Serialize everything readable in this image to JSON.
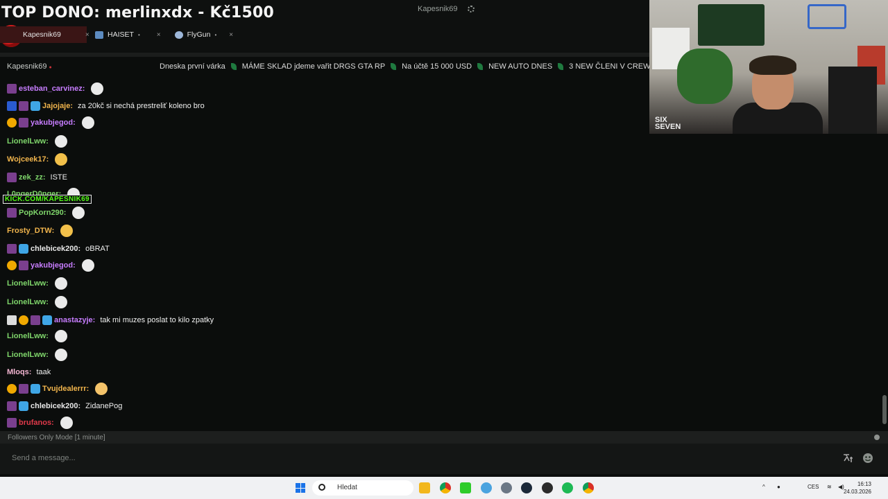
{
  "overlay": {
    "top_title": "TOP DONO: merlinxdx - Kč1500",
    "center_channel": "Kapesnik69"
  },
  "tabs": [
    {
      "label": "Kapesnik69",
      "close": "×"
    },
    {
      "label": "HAISET",
      "dot": "•",
      "close": "×"
    },
    {
      "label": "FlyGun",
      "dot": "•",
      "close": "×"
    }
  ],
  "channel": {
    "name": "Kapesnik69",
    "ticker": [
      "Dneska první várka",
      "MÁME SKLAD jdeme vařit DRGS GTA RP",
      "Na účtě 15 000 USD",
      "NEW AUTO DNES",
      "3 NEW ČLENI V CREW"
    ]
  },
  "webcam": {
    "overlay_text": "SIX SEVEN"
  },
  "kick_overlay": "KICK.COM/KAPESNIK69",
  "chat": [
    {
      "badges": [
        "sub"
      ],
      "user": "esteban_carvinez:",
      "color": "#c77dff",
      "text": "",
      "emote": "skull-emote"
    },
    {
      "badges": [
        "mod",
        "sub",
        "gift"
      ],
      "user": "Jajojaje:",
      "color": "#f0b44c",
      "text": "za 20kč si nechá prestreliť koleno bro",
      "emote": ""
    },
    {
      "badges": [
        "one",
        "sub"
      ],
      "user": "yakubjegod:",
      "color": "#c77dff",
      "text": "",
      "emote": "skull-emote"
    },
    {
      "badges": [],
      "user": "LionelLww:",
      "color": "#7fd66b",
      "text": "",
      "emote": "skull-emote"
    },
    {
      "badges": [],
      "user": "Wojceek17:",
      "color": "#f0b44c",
      "text": "",
      "emote": "laugh-emote"
    },
    {
      "badges": [
        "sub"
      ],
      "user": "zek_zz:",
      "color": "#7fd66b",
      "text": "ISTE",
      "emote": ""
    },
    {
      "badges": [],
      "user": "L0ngerD0nger:",
      "color": "#7fd66b",
      "text": "",
      "emote": "skull-emote"
    },
    {
      "badges": [
        "sub"
      ],
      "user": "PopKorn290:",
      "color": "#7fd66b",
      "text": "",
      "emote": "skull-emote"
    },
    {
      "badges": [],
      "user": "Frosty_DTW:",
      "color": "#f0b44c",
      "text": "",
      "emote": "laugh-emote"
    },
    {
      "badges": [
        "sub",
        "gift"
      ],
      "user": "chlebicek200:",
      "color": "#e8e8e8",
      "text": "oBRAT",
      "emote": ""
    },
    {
      "badges": [
        "one",
        "sub"
      ],
      "user": "yakubjegod:",
      "color": "#c77dff",
      "text": "",
      "emote": "skull-emote"
    },
    {
      "badges": [],
      "user": "LionelLww:",
      "color": "#7fd66b",
      "text": "",
      "emote": "skull-emote"
    },
    {
      "badges": [],
      "user": "LionelLww:",
      "color": "#7fd66b",
      "text": "",
      "emote": "skull-emote"
    },
    {
      "badges": [
        "vip",
        "one",
        "sub",
        "gift"
      ],
      "user": "anastazyje:",
      "color": "#c77dff",
      "text": "tak mi muzes poslat to kilo zpatky",
      "emote": ""
    },
    {
      "badges": [],
      "user": "LionelLww:",
      "color": "#7fd66b",
      "text": "",
      "emote": "skull-emote"
    },
    {
      "badges": [],
      "user": "LionelLww:",
      "color": "#7fd66b",
      "text": "",
      "emote": "skull-emote"
    },
    {
      "badges": [],
      "user": "Mloqs:",
      "color": "#f4b6d2",
      "text": "taak",
      "emote": ""
    },
    {
      "badges": [
        "one",
        "sub",
        "gift"
      ],
      "user": "Tvujdealerrr:",
      "color": "#f0b44c",
      "text": "",
      "emote": "sad-emote"
    },
    {
      "badges": [
        "sub",
        "gift"
      ],
      "user": "chlebicek200:",
      "color": "#e8e8e8",
      "text": "ZidanePog",
      "emote": ""
    },
    {
      "badges": [
        "sub"
      ],
      "user": "brufanos:",
      "color": "#e0394a",
      "text": "",
      "emote": "skull-emote"
    }
  ],
  "footer": {
    "followers_mode": "Followers Only Mode [1 minute]",
    "message_placeholder": "Send a message..."
  },
  "taskbar": {
    "search_placeholder": "Hledat",
    "lang": "CES",
    "time": "16:13",
    "date": "24.03.2026"
  }
}
